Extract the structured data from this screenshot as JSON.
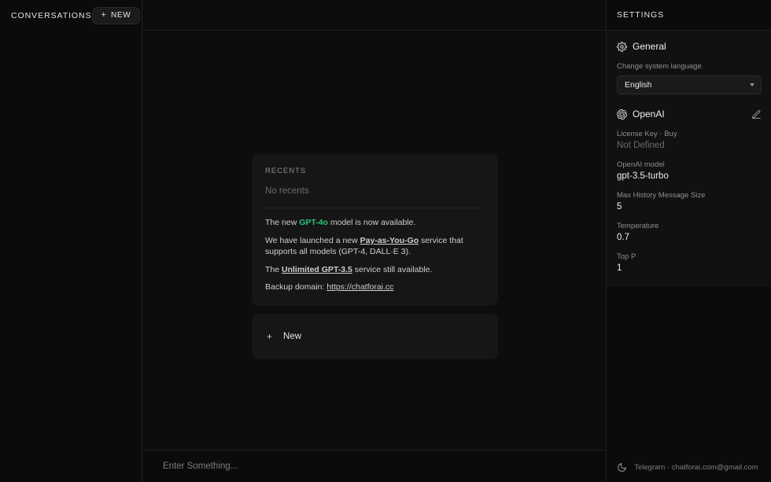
{
  "sidebar": {
    "title": "CONVERSATIONS",
    "new_button": {
      "plus": "+",
      "label": "NEW"
    }
  },
  "main": {
    "recents": {
      "heading": "RECENTS",
      "empty_text": "No recents"
    },
    "notices": [
      {
        "prefix": "The new ",
        "highlight": "GPT-4o",
        "suffix": " model is now available."
      },
      {
        "prefix": "We have launched a new ",
        "link": "Pay-as-You-Go",
        "suffix": " service that supports all models (GPT-4, DALL·E 3)."
      },
      {
        "prefix": "The ",
        "link": "Unlimited GPT-3.5",
        "suffix": " service still available."
      },
      {
        "prefix": "Backup domain: ",
        "link": "https://chatforai.cc",
        "suffix": ""
      }
    ],
    "new_card": {
      "plus": "+",
      "label": "New"
    },
    "composer": {
      "placeholder": "Enter Something...",
      "value": ""
    }
  },
  "settings": {
    "title": "SETTINGS",
    "general": {
      "section_title": "General",
      "language_label": "Change system language",
      "language_value": "English"
    },
    "openai": {
      "section_title": "OpenAI",
      "fields": [
        {
          "label": "License Key · Buy",
          "value": "Not Defined",
          "muted": true
        },
        {
          "label": "OpenAI model",
          "value": "gpt-3.5-turbo",
          "muted": false
        },
        {
          "label": "Max History Message Size",
          "value": "5",
          "muted": false
        },
        {
          "label": "Temperature",
          "value": "0.7",
          "muted": false
        },
        {
          "label": "Top P",
          "value": "1",
          "muted": false
        }
      ]
    },
    "footer": {
      "text": "Telegram · chatforai.com@gmail.com"
    }
  },
  "colors": {
    "background": "#0b0b0b",
    "card": "#161616",
    "accent_green": "#2ec07a",
    "text_primary": "#ededed",
    "text_muted": "#8f8f8f"
  }
}
